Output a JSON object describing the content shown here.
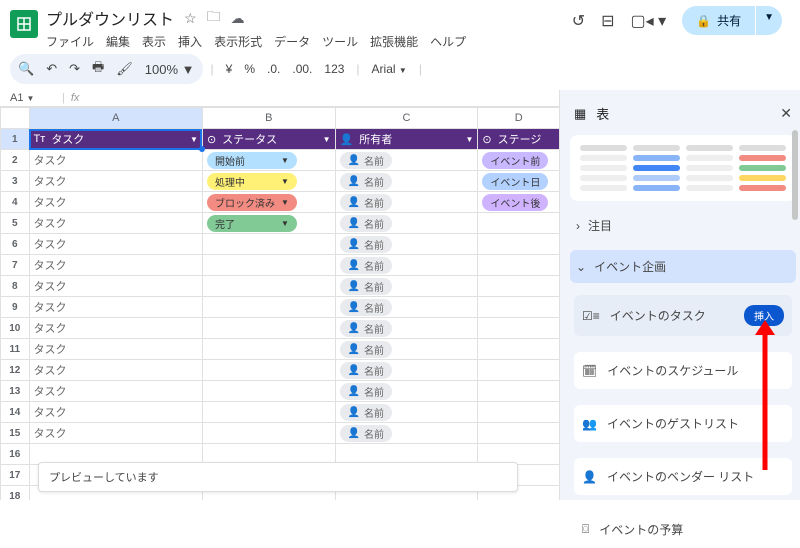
{
  "doc": {
    "title": "プルダウンリスト"
  },
  "menu": [
    "ファイル",
    "編集",
    "表示",
    "挿入",
    "表示形式",
    "データ",
    "ツール",
    "拡張機能",
    "ヘルプ"
  ],
  "share": {
    "label": "共有"
  },
  "toolbar": {
    "zoom": "100%",
    "currency": "¥",
    "percent": "%",
    "dec0": ".0.",
    "dec00": ".00.",
    "num": "123",
    "font": "Arial"
  },
  "namebox": "A1",
  "columns": [
    "A",
    "B",
    "C",
    "D"
  ],
  "header": [
    {
      "icon": "Tт",
      "label": "タスク"
    },
    {
      "icon": "⊙",
      "label": "ステータス"
    },
    {
      "icon": "👤",
      "label": "所有者"
    },
    {
      "icon": "⊙",
      "label": "ステージ"
    }
  ],
  "statuses": [
    {
      "text": "開始前",
      "bg": "#b3e0ff"
    },
    {
      "text": "処理中",
      "bg": "#fff176"
    },
    {
      "text": "ブロック済み",
      "bg": "#f28b82"
    },
    {
      "text": "完了",
      "bg": "#81c995"
    }
  ],
  "stages": [
    {
      "text": "イベント前",
      "bg": "#c7b8ff"
    },
    {
      "text": "イベント日",
      "bg": "#b3d1ff"
    },
    {
      "text": "イベント後",
      "bg": "#d0b3ff"
    }
  ],
  "taskLabel": "タスク",
  "nameLabel": "名前",
  "rows": 15,
  "banner": "プレビューしています",
  "panel": {
    "title": "表",
    "acc1": "注目",
    "acc2": "イベント企画",
    "templates": [
      {
        "icon": "checklist",
        "label": "イベントのタスク",
        "insert": true
      },
      {
        "icon": "calendar",
        "label": "イベントのスケジュール"
      },
      {
        "icon": "people",
        "label": "イベントのゲストリスト"
      },
      {
        "icon": "person",
        "label": "イベントのベンダー リスト"
      },
      {
        "icon": "money",
        "label": "イベントの予算"
      }
    ],
    "insertLabel": "挿入"
  }
}
